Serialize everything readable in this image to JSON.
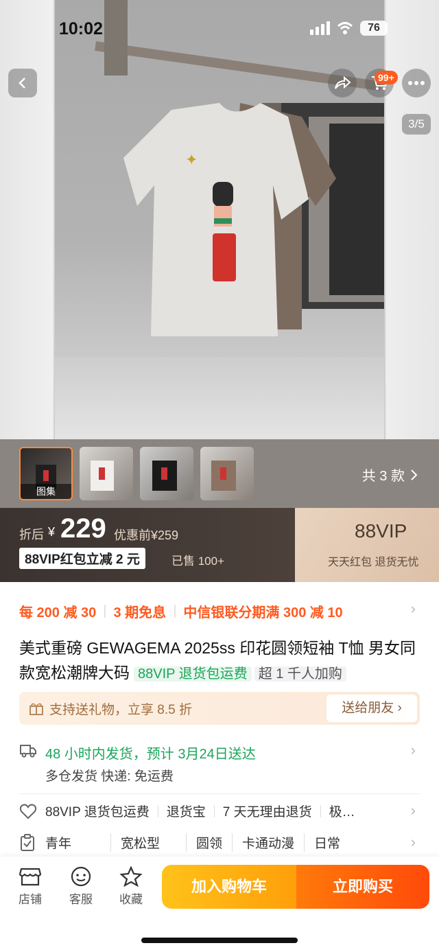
{
  "status_bar": {
    "time": "10:02",
    "battery": "76"
  },
  "header": {
    "cart_badge": "99+",
    "page_indicator": "3/5"
  },
  "gallery": {
    "thumbs": [
      {
        "label": "图集",
        "active": true
      },
      {
        "label": "",
        "active": false
      },
      {
        "label": "",
        "active": false
      },
      {
        "label": "",
        "active": false
      }
    ],
    "variant_count": "共 3 款"
  },
  "price": {
    "prefix": "折后",
    "currency": "¥",
    "value": "229",
    "original": "优惠前¥259",
    "coupon": "88VIP红包立减 2 元",
    "sold": "已售 100+",
    "vip_title": "88VIP",
    "vip_sub": "天天红包  退货无忧"
  },
  "promotions": [
    "每 200 减 30",
    "3 期免息",
    "中信银联分期满 300 减 10"
  ],
  "product": {
    "title": "美式重磅 GEWAGEMA 2025ss 印花圆领短袖 T恤 男女同款宽松潮牌大码",
    "tag_green": "88VIP 退货包运费",
    "tag_hot": "超 1 千人加购"
  },
  "gift": {
    "text": "支持送礼物，立享 8.5 折",
    "button": "送给朋友 ›"
  },
  "shipping": {
    "main": "48 小时内发货，预计 3月24日送达",
    "sub": "多仓发货  快递: 免运费"
  },
  "services": [
    "88VIP 退货包运费",
    "退货宝",
    "7 天无理由退货",
    "极…"
  ],
  "attributes": [
    "青年",
    "宽松型",
    "圆领",
    "卡通动漫",
    "日常"
  ],
  "bottom_nav": {
    "shop": "店铺",
    "service": "客服",
    "favorite": "收藏"
  },
  "actions": {
    "add_to_cart": "加入购物车",
    "buy_now": "立即购买"
  },
  "colors": {
    "accent_orange": "#ff5a1f",
    "green": "#1ba55a",
    "cart_btn": "#ffb30f",
    "buy_btn": "#ff5a0a"
  }
}
